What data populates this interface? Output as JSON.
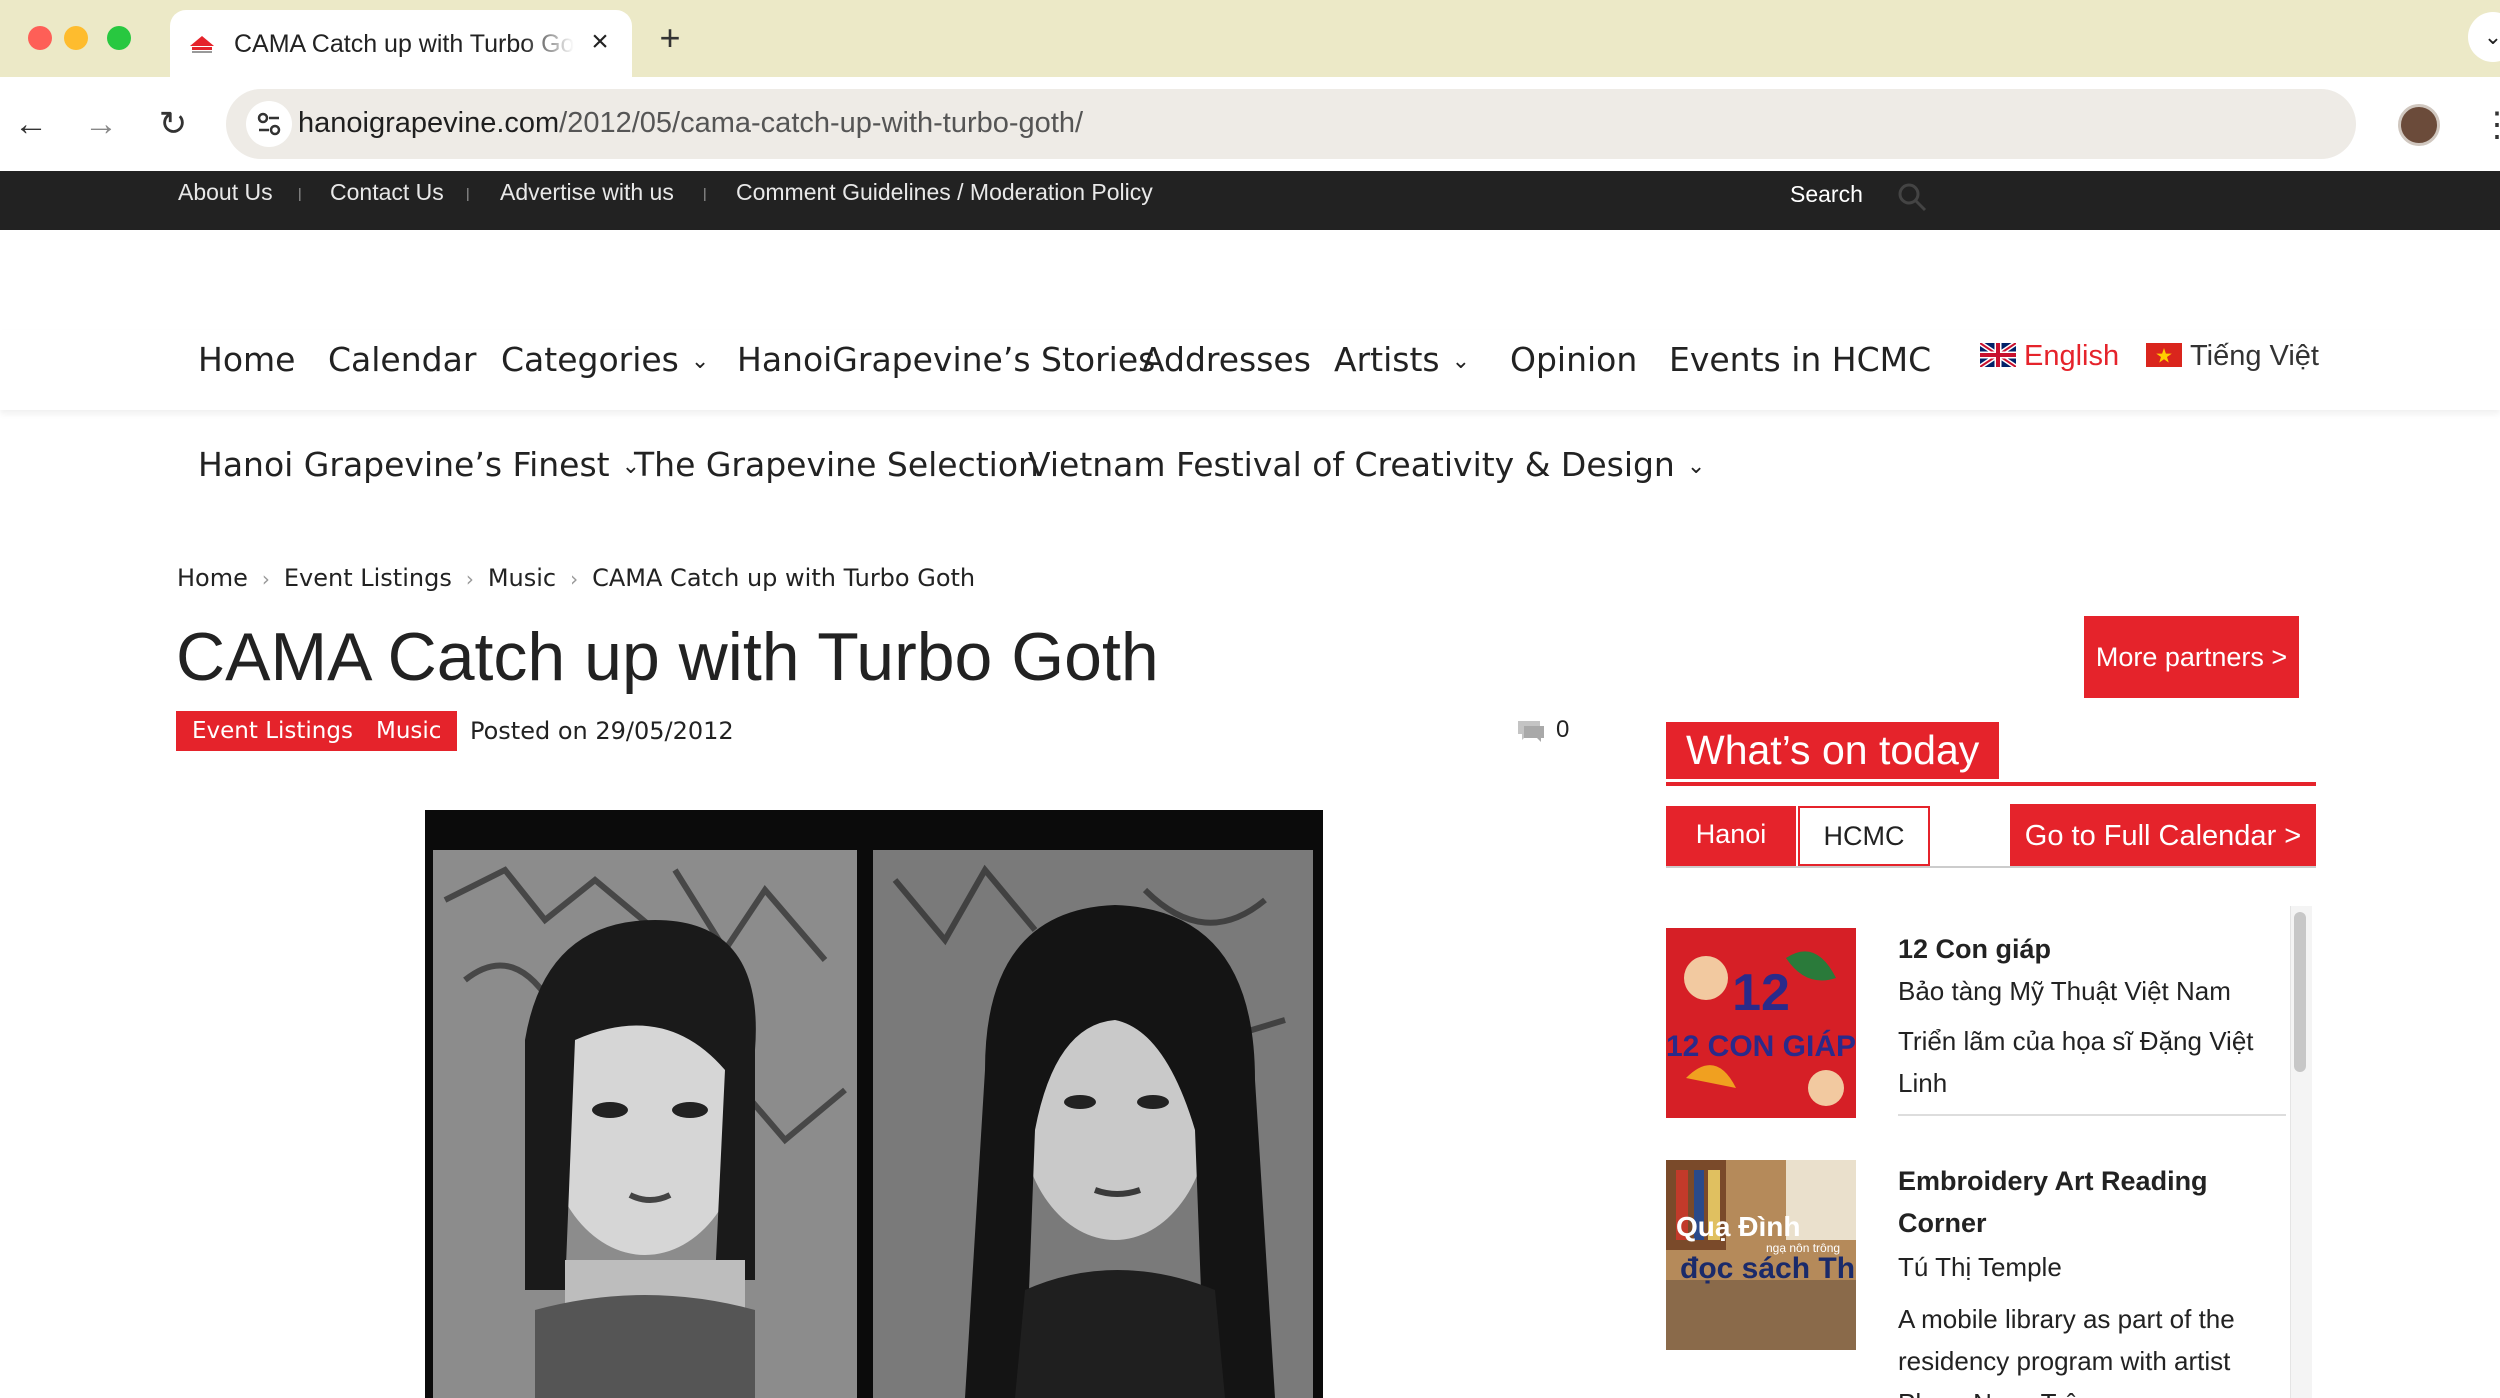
{
  "browser": {
    "tab_title": "CAMA Catch up with Turbo Goth",
    "url_host": "hanoigrapevine.com",
    "url_path": "/2012/05/cama-catch-up-with-turbo-goth/"
  },
  "topbar": {
    "links": [
      "About Us",
      "Contact Us",
      "Advertise with us",
      "Comment Guidelines / Moderation Policy"
    ],
    "separator": "|",
    "search_label": "Search"
  },
  "nav": {
    "row1": [
      "Home",
      "Calendar",
      "Categories",
      "HanoiGrapevine’s Stories",
      "Addresses",
      "Artists",
      "Opinion",
      "Events in HCMC"
    ],
    "row2": [
      "Hanoi Grapevine’s Finest",
      "The Grapevine Selection",
      "Vietnam Festival of Creativity & Design"
    ],
    "lang_en": "English",
    "lang_vi": "Tiếng Việt"
  },
  "breadcrumb": [
    "Home",
    "Event Listings",
    "Music",
    "CAMA Catch up with Turbo Goth"
  ],
  "article": {
    "title": "CAMA Catch up with Turbo Goth",
    "tags": [
      "Event Listings",
      "Music"
    ],
    "posted": "Posted on 29/05/2012",
    "comment_count": "0"
  },
  "sidebar": {
    "partners_button": "More partners >",
    "whats_on_title": "What’s on today",
    "city_tabs": [
      "Hanoi",
      "HCMC"
    ],
    "full_calendar": "Go to Full Calendar >",
    "events": [
      {
        "title": "12 Con giáp",
        "venue": "Bảo tàng Mỹ Thuật Việt Nam",
        "desc": "Triển lãm của họa sĩ Đặng Việt Linh",
        "thumb_text": "12 CON GIÁP"
      },
      {
        "title": "Embroidery Art Reading Corner",
        "venue": "Tú Thị Temple",
        "desc": "A mobile library as part of the residency program with artist Phạm Ngọc Trâm",
        "thumb_text_1": "Quạ Đình",
        "thumb_text_2": "đọc sách Th",
        "thumb_text_3": "ngạ nôn trông"
      }
    ]
  },
  "colors": {
    "accent": "#e5232b",
    "topbar_bg": "#222222",
    "chrome_tabbar": "#ece9c7"
  }
}
